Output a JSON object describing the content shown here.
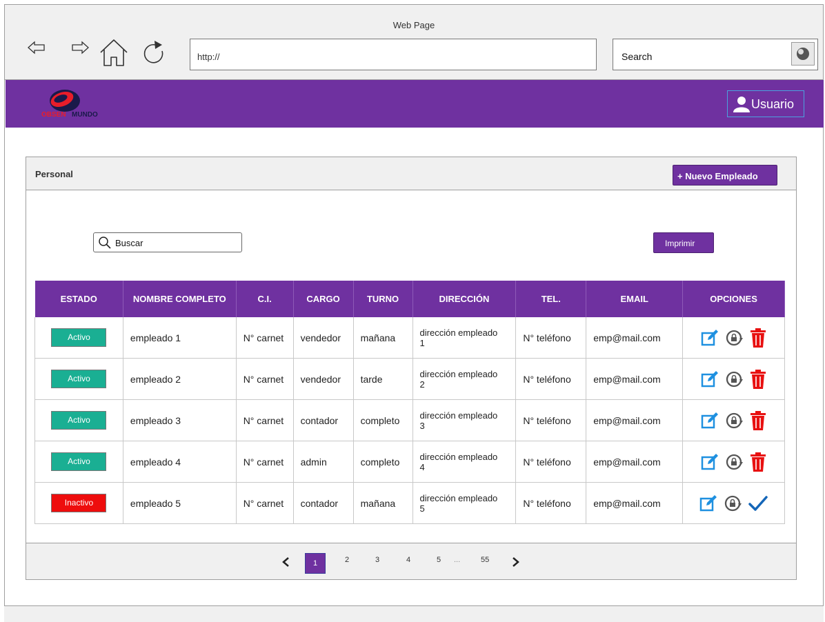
{
  "browser": {
    "title": "Web Page",
    "url": "http://",
    "search_label": "Search"
  },
  "header": {
    "brand_part1": "OBSEN",
    "brand_part2": "MUNDO",
    "user_label": "Usuario"
  },
  "panel": {
    "title": "Personal",
    "new_button": "+ Nuevo Empleado",
    "search_placeholder": "Buscar",
    "print_button": "Imprimir"
  },
  "table": {
    "columns": [
      "ESTADO",
      "NOMBRE COMPLETO",
      "C.I.",
      "CARGO",
      "TURNO",
      "DIRECCIÓN",
      "TEL.",
      "EMAIL",
      "OPCIONES"
    ],
    "rows": [
      {
        "estado": "Activo",
        "nombre": "empleado 1",
        "ci": "N° carnet",
        "cargo": "vendedor",
        "turno": "mañana",
        "dir1": "dirección empleado",
        "dir2": "1",
        "tel": "N° teléfono",
        "email": "emp@mail.com"
      },
      {
        "estado": "Activo",
        "nombre": "empleado 2",
        "ci": "N° carnet",
        "cargo": "vendedor",
        "turno": "tarde",
        "dir1": "dirección empleado",
        "dir2": "2",
        "tel": "N° teléfono",
        "email": "emp@mail.com"
      },
      {
        "estado": "Activo",
        "nombre": "empleado 3",
        "ci": "N° carnet",
        "cargo": "contador",
        "turno": "completo",
        "dir1": "dirección empleado",
        "dir2": "3",
        "tel": "N° teléfono",
        "email": "emp@mail.com"
      },
      {
        "estado": "Activo",
        "nombre": "empleado 4",
        "ci": "N° carnet",
        "cargo": "admin",
        "turno": "completo",
        "dir1": "dirección empleado",
        "dir2": "4",
        "tel": "N° teléfono",
        "email": "emp@mail.com"
      },
      {
        "estado": "Inactivo",
        "nombre": "empleado 5",
        "ci": "N° carnet",
        "cargo": "contador",
        "turno": "mañana",
        "dir1": "dirección empleado",
        "dir2": "5",
        "tel": "N° teléfono",
        "email": "emp@mail.com"
      }
    ]
  },
  "pagination": {
    "pages": [
      "1",
      "2",
      "3",
      "4",
      "5",
      "...",
      "55"
    ],
    "current": "1"
  },
  "colors": {
    "accent": "#6f31a0",
    "active": "#1aaf93",
    "inactive": "#ee0d0d",
    "edit": "#1e90e0",
    "delete": "#e81010",
    "check": "#1466b8"
  }
}
